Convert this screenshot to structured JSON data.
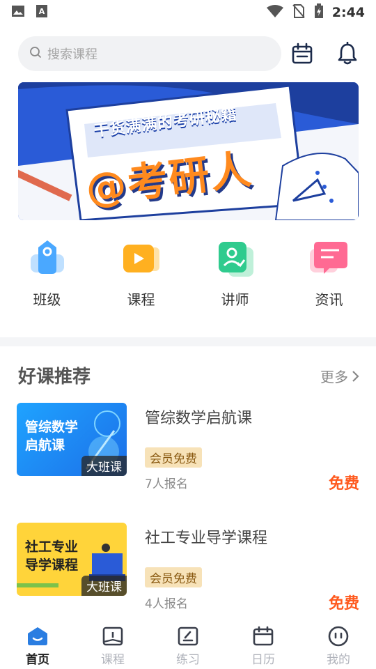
{
  "status_bar": {
    "time": "2:44"
  },
  "header": {
    "search_placeholder": "搜索课程"
  },
  "banner": {
    "subtitle": "干货满满的考研秘籍",
    "title": "@考研人"
  },
  "quick_nav": [
    {
      "label": "班级",
      "icon": "class-icon",
      "color": "#4aa8ff"
    },
    {
      "label": "课程",
      "icon": "course-icon",
      "color": "#ffb020"
    },
    {
      "label": "讲师",
      "icon": "teacher-icon",
      "color": "#2fcb8e"
    },
    {
      "label": "资讯",
      "icon": "news-icon",
      "color": "#ff6a93"
    }
  ],
  "recommend": {
    "title": "好课推荐",
    "more": "更多",
    "courses": [
      {
        "thumb_line1": "管综数学",
        "thumb_line2": "启航课",
        "badge": "大班课",
        "title": "管综数学启航课",
        "tag": "会员免费",
        "enroll": "7人报名",
        "price": "免费"
      },
      {
        "thumb_line1": "社工专业",
        "thumb_line2": "导学课程",
        "badge": "大班课",
        "title": "社工专业导学课程",
        "tag": "会员免费",
        "enroll": "4人报名",
        "price": "免费"
      }
    ]
  },
  "tabs": [
    {
      "label": "首页",
      "icon": "home-icon",
      "active": true
    },
    {
      "label": "课程",
      "icon": "book-icon",
      "active": false
    },
    {
      "label": "练习",
      "icon": "practice-icon",
      "active": false
    },
    {
      "label": "日历",
      "icon": "calendar-icon",
      "active": false
    },
    {
      "label": "我的",
      "icon": "profile-icon",
      "active": false
    }
  ],
  "colors": {
    "accent": "#2a7de1",
    "price": "#ff5a1f",
    "banner_bg": "#2a5bd7"
  }
}
